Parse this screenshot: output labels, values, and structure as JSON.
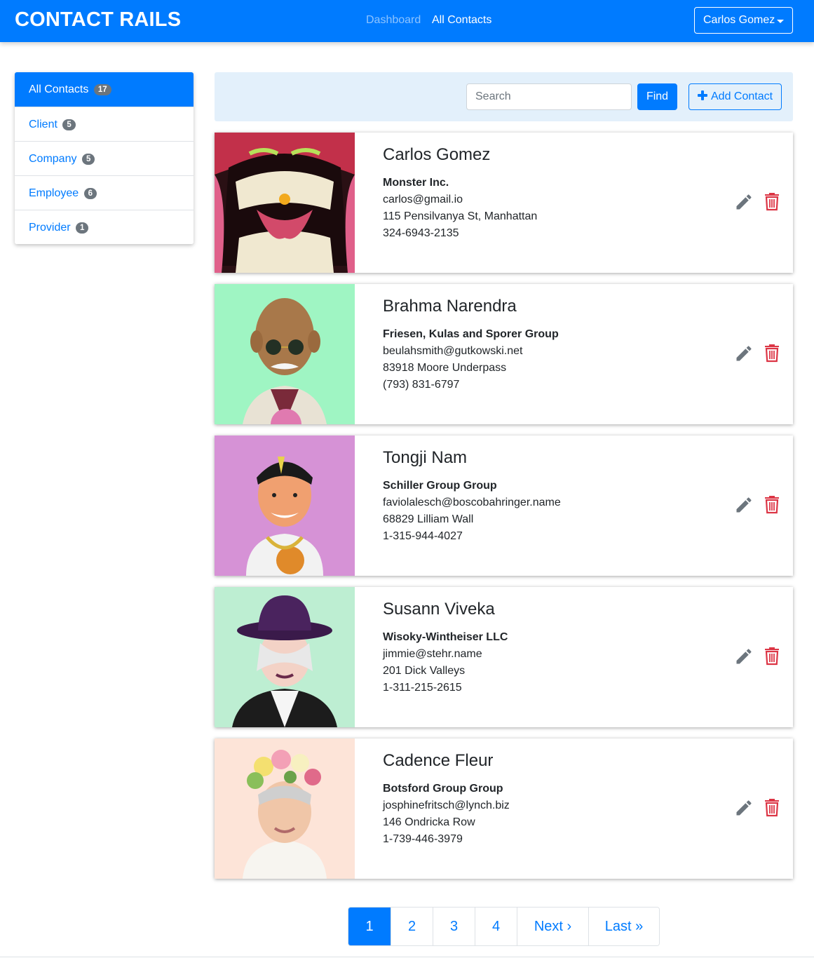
{
  "navbar": {
    "brand": "CONTACT RAILS",
    "links": [
      "Dashboard",
      "All Contacts"
    ],
    "user": "Carlos Gomez"
  },
  "sidebar": {
    "items": [
      {
        "label": "All Contacts",
        "count": "17",
        "active": true
      },
      {
        "label": "Client",
        "count": "5"
      },
      {
        "label": "Company",
        "count": "5"
      },
      {
        "label": "Employee",
        "count": "6"
      },
      {
        "label": "Provider",
        "count": "1"
      }
    ]
  },
  "search": {
    "placeholder": "Search",
    "find_label": "Find",
    "add_label": "Add Contact"
  },
  "contacts": [
    {
      "name": "Carlos Gomez",
      "company": "Monster Inc.",
      "email": "carlos@gmail.io",
      "address": "115 Pensilvanya St, Manhattan",
      "phone": "324-6943-2135",
      "avatar_bg": "#2a1014"
    },
    {
      "name": "Brahma Narendra",
      "company": "Friesen, Kulas and Sporer Group",
      "email": "beulahsmith@gutkowski.net",
      "address": "83918 Moore Underpass",
      "phone": "(793) 831-6797",
      "avatar_bg": "#9ff5c3"
    },
    {
      "name": "Tongji Nam",
      "company": "Schiller Group Group",
      "email": "faviolalesch@boscobahringer.name",
      "address": "68829 Lilliam Wall",
      "phone": "1-315-944-4027",
      "avatar_bg": "#d692d6"
    },
    {
      "name": "Susann Viveka",
      "company": "Wisoky-Wintheiser LLC",
      "email": "jimmie@stehr.name",
      "address": "201 Dick Valleys",
      "phone": "1-311-215-2615",
      "avatar_bg": "#bdeed2"
    },
    {
      "name": "Cadence Fleur",
      "company": "Botsford Group Group",
      "email": "josphinefritsch@lynch.biz",
      "address": "146 Ondricka Row",
      "phone": "1-739-446-3979",
      "avatar_bg": "#fde4d8"
    }
  ],
  "pagination": {
    "pages": [
      "1",
      "2",
      "3",
      "4"
    ],
    "next": "Next ›",
    "last": "Last »",
    "current": "1"
  },
  "colors": {
    "primary": "#007bff",
    "danger": "#dc3545",
    "muted": "#6c757d"
  }
}
